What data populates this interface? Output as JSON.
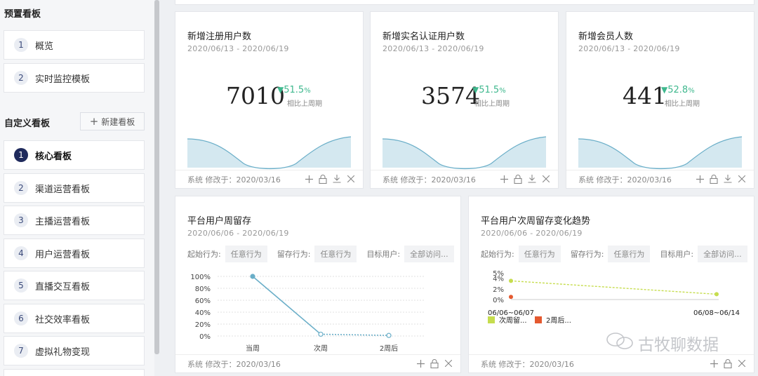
{
  "sidebar": {
    "preset_title": "预置看板",
    "preset_items": [
      {
        "num": "1",
        "label": "概览"
      },
      {
        "num": "2",
        "label": "实时监控模板"
      }
    ],
    "custom_title": "自定义看板",
    "new_board_label": "新建看板",
    "custom_items": [
      {
        "num": "1",
        "label": "核心看板"
      },
      {
        "num": "2",
        "label": "渠道运营看板"
      },
      {
        "num": "3",
        "label": "主播运营看板"
      },
      {
        "num": "4",
        "label": "用户运营看板"
      },
      {
        "num": "5",
        "label": "直播交互看板"
      },
      {
        "num": "6",
        "label": "社交效率看板"
      },
      {
        "num": "7",
        "label": "虚拟礼物变现"
      }
    ]
  },
  "metric_cards": [
    {
      "title": "新增注册用户数",
      "date": "2020/06/13 - 2020/06/19",
      "value": "7010",
      "delta": "51.5",
      "delta_unit": "%",
      "delta_note": "相比上周期",
      "footer": "系统  修改于：2020/03/16"
    },
    {
      "title": "新增实名认证用户数",
      "date": "2020/06/13 - 2020/06/19",
      "value": "3574",
      "delta": "51.5",
      "delta_unit": "%",
      "delta_note": "相比上周期",
      "footer": "系统  修改于：2020/03/16"
    },
    {
      "title": "新增会员人数",
      "date": "2020/06/13 - 2020/06/19",
      "value": "441",
      "delta": "52.8",
      "delta_unit": "%",
      "delta_note": "相比上周期",
      "footer": "系统  修改于：2020/03/16"
    }
  ],
  "retention_card": {
    "title": "平台用户周留存",
    "date": "2020/06/06 - 2020/06/19",
    "filters": {
      "start_label": "起始行为:",
      "start_value": "任意行为",
      "retain_label": "留存行为:",
      "retain_value": "任意行为",
      "target_label": "目标用户:",
      "target_value": "全部访问..."
    },
    "footer": "系统  修改于：2020/03/16"
  },
  "trend_card": {
    "title": "平台用户次周留存变化趋势",
    "date": "2020/06/06 - 2020/06/19",
    "filters": {
      "start_label": "起始行为:",
      "start_value": "任意行为",
      "retain_label": "留存行为:",
      "retain_value": "任意行为",
      "target_label": "目标用户:",
      "target_value": "全部访问..."
    },
    "footer": "系统  修改于：2020/03/16"
  },
  "colors": {
    "accent": "#1f2a5c",
    "up": "#3fb88e",
    "line": "#6aaec8",
    "series1": "#c6dd4e",
    "series2": "#e4592f"
  },
  "watermark": "古牧聊数据",
  "chart_data": [
    {
      "type": "line",
      "title": "",
      "x": [
        "当周",
        "次周",
        "2周后"
      ],
      "ylim": [
        0,
        100
      ],
      "yticks": [
        "100%",
        "80%",
        "60%",
        "40%",
        "20%",
        "0%"
      ],
      "series": [
        {
          "values": [
            100,
            3,
            1
          ]
        }
      ],
      "grid": true
    },
    {
      "type": "line",
      "title": "",
      "x": [
        "06/06~06/07",
        "06/08~06/14"
      ],
      "ylim": [
        0,
        5
      ],
      "yticks": [
        "5%",
        "4%",
        "2%",
        "0%"
      ],
      "series": [
        {
          "name": "次周留...",
          "values": [
            3.5,
            1.0
          ]
        },
        {
          "name": "2周后...",
          "values": [
            0.5,
            null
          ]
        }
      ],
      "legend": "bottom-left"
    }
  ]
}
